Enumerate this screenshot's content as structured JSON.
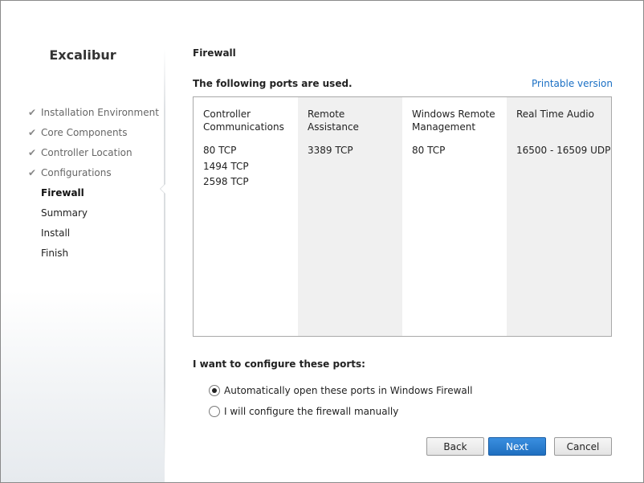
{
  "product": {
    "title": "Excalibur"
  },
  "steps": [
    {
      "label": "Installation Environment",
      "state": "done"
    },
    {
      "label": "Core Components",
      "state": "done"
    },
    {
      "label": "Controller Location",
      "state": "done"
    },
    {
      "label": "Configurations",
      "state": "done"
    },
    {
      "label": "Firewall",
      "state": "current"
    },
    {
      "label": "Summary",
      "state": "pending"
    },
    {
      "label": "Install",
      "state": "pending"
    },
    {
      "label": "Finish",
      "state": "pending"
    }
  ],
  "check_glyph": "✔",
  "page": {
    "title": "Firewall",
    "ports_heading": "The following ports are used.",
    "printable_link": "Printable version",
    "configure_heading": "I want to configure these ports:"
  },
  "ports": [
    {
      "header": "Controller Communications",
      "entries": [
        "80  TCP",
        "1494  TCP",
        "2598  TCP"
      ],
      "shaded": false
    },
    {
      "header": "Remote Assistance",
      "entries": [
        "3389  TCP"
      ],
      "shaded": true
    },
    {
      "header": "Windows Remote Management",
      "entries": [
        "80  TCP"
      ],
      "shaded": false
    },
    {
      "header": "Real Time Audio",
      "entries": [
        "16500 - 16509  UDP"
      ],
      "shaded": true
    }
  ],
  "options": {
    "auto": {
      "label": "Automatically open these ports in Windows Firewall",
      "selected": true
    },
    "manual": {
      "label": "I will configure the firewall manually",
      "selected": false
    }
  },
  "buttons": {
    "back": "Back",
    "next": "Next",
    "cancel": "Cancel"
  },
  "colors": {
    "link": "#1a6fc4",
    "primary_button": "#1f6fc0"
  }
}
